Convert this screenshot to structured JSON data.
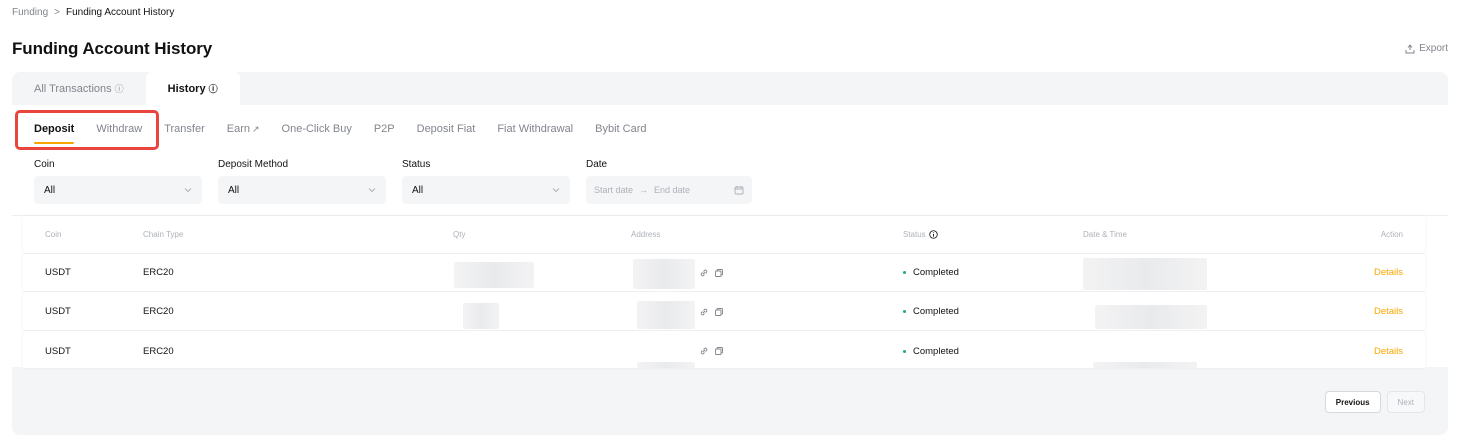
{
  "breadcrumb": {
    "parent": "Funding",
    "separator": ">",
    "current": "Funding Account History"
  },
  "header": {
    "title": "Funding Account History",
    "export_label": "Export"
  },
  "top_tabs": [
    {
      "label": "All Transactions",
      "icon": "question-circle-icon"
    },
    {
      "label": "History",
      "icon": "question-circle-icon",
      "active": true
    }
  ],
  "sub_tabs": [
    {
      "label": "Deposit",
      "active": true
    },
    {
      "label": "Withdraw"
    },
    {
      "label": "Transfer"
    },
    {
      "label": "Earn",
      "icon": "external-link-icon"
    },
    {
      "label": "One-Click Buy"
    },
    {
      "label": "P2P"
    },
    {
      "label": "Deposit Fiat"
    },
    {
      "label": "Fiat Withdrawal"
    },
    {
      "label": "Bybit Card"
    }
  ],
  "filters": {
    "coin": {
      "label": "Coin",
      "value": "All"
    },
    "deposit_method": {
      "label": "Deposit Method",
      "value": "All"
    },
    "status": {
      "label": "Status",
      "value": "All"
    },
    "date": {
      "label": "Date",
      "start_placeholder": "Start date",
      "arrow": "→",
      "end_placeholder": "End date"
    }
  },
  "table": {
    "columns": [
      "Coin",
      "Chain Type",
      "Qty",
      "Address",
      "Status",
      "Date & Time",
      "Action"
    ],
    "rows": [
      {
        "coin": "USDT",
        "chain": "ERC20",
        "status": "Completed",
        "action": "Details"
      },
      {
        "coin": "USDT",
        "chain": "ERC20",
        "status": "Completed",
        "action": "Details"
      },
      {
        "coin": "USDT",
        "chain": "ERC20",
        "status": "Completed",
        "action": "Details"
      }
    ]
  },
  "pagination": {
    "previous": "Previous",
    "next": "Next"
  },
  "colors": {
    "accent": "#f7a600",
    "success": "#20b26c",
    "highlight": "#e8453d"
  }
}
